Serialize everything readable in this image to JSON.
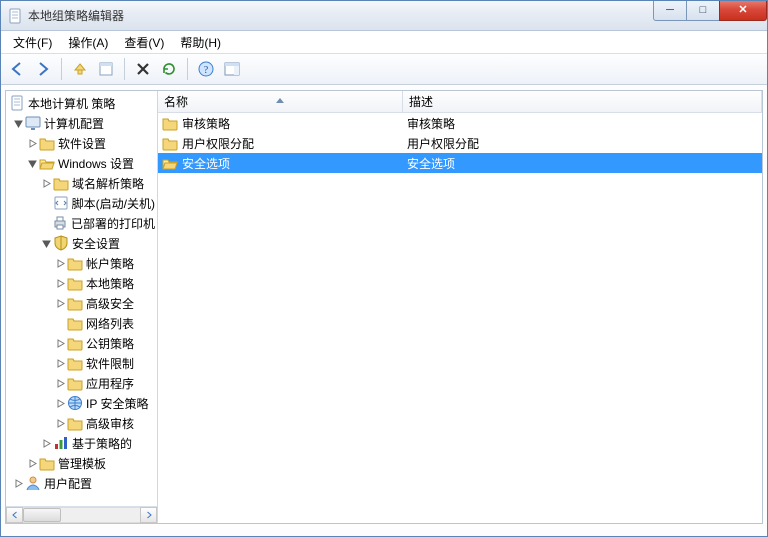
{
  "window": {
    "title": "本地组策略编辑器"
  },
  "menu": {
    "file": "文件(F)",
    "action": "操作(A)",
    "view": "查看(V)",
    "help": "帮助(H)"
  },
  "tree": {
    "root": "本地计算机 策略",
    "computer_config": "计算机配置",
    "software_settings": "软件设置",
    "windows_settings": "Windows 设置",
    "dns": "域名解析策略",
    "scripts": "脚本(启动/关机)",
    "deployed": "已部署的打印机",
    "security_settings": "安全设置",
    "account_policy": "帐户策略",
    "local_policy": "本地策略",
    "advanced_sec": "高级安全",
    "network": "网络列表",
    "pubkey": "公钥策略",
    "software_restrict": "软件限制",
    "app": "应用程序",
    "ipsec": "IP 安全策略",
    "advanced_audit": "高级审核",
    "policy_based": "基于策略的",
    "admin_templates": "管理模板",
    "user_config": "用户配置"
  },
  "columns": {
    "name": "名称",
    "desc": "描述"
  },
  "rows": [
    {
      "name": "审核策略",
      "desc": "审核策略",
      "icon": "folder",
      "selected": false
    },
    {
      "name": "用户权限分配",
      "desc": "用户权限分配",
      "icon": "folder",
      "selected": false
    },
    {
      "name": "安全选项",
      "desc": "安全选项",
      "icon": "folder-open",
      "selected": true
    }
  ]
}
